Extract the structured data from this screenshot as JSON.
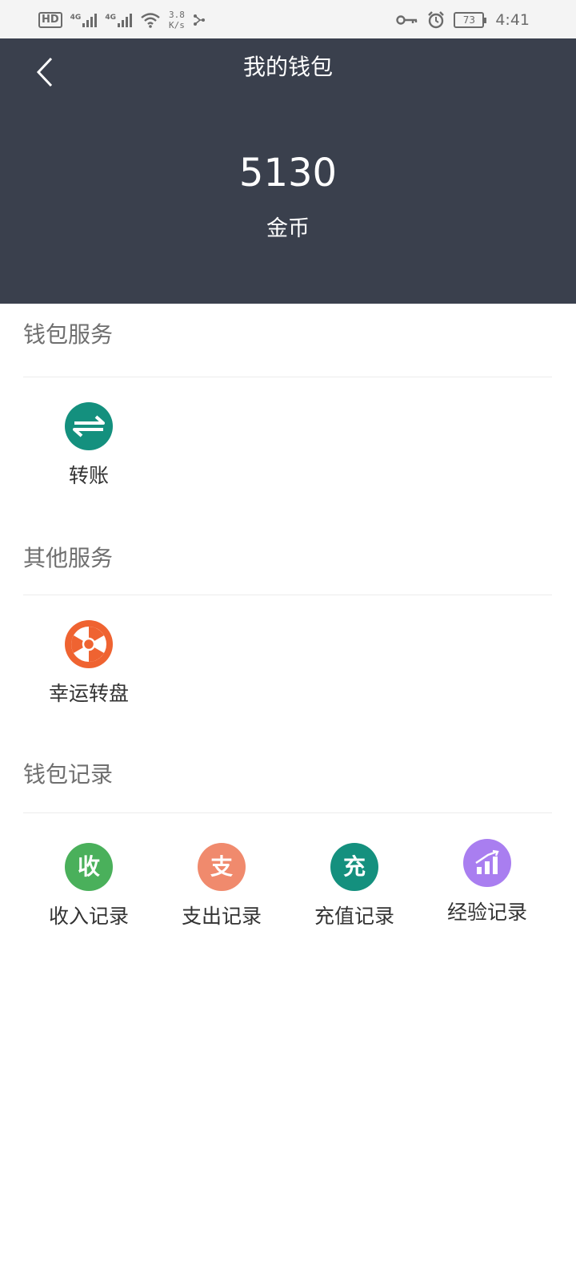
{
  "status_bar": {
    "hd": "HD",
    "network_1": "4G",
    "network_2": "4G",
    "speed_value": "3.8",
    "speed_unit": "K/s",
    "battery": "73",
    "time": "4:41"
  },
  "header": {
    "title": "我的钱包",
    "balance": "5130",
    "unit": "金币",
    "background_color": "#3a404d"
  },
  "sections": [
    {
      "title": "钱包服务",
      "items": [
        {
          "label": "转账",
          "icon": "transfer-arrows-icon",
          "color": "#14907e"
        }
      ]
    },
    {
      "title": "其他服务",
      "items": [
        {
          "label": "幸运转盘",
          "icon": "lucky-wheel-icon",
          "color": "#ef6331"
        }
      ]
    },
    {
      "title": "钱包记录",
      "items": [
        {
          "label": "收入记录",
          "icon": "income-icon",
          "glyph": "收",
          "color": "#4ab05b"
        },
        {
          "label": "支出记录",
          "icon": "expense-icon",
          "glyph": "支",
          "color": "#f08a6d"
        },
        {
          "label": "充值记录",
          "icon": "recharge-icon",
          "glyph": "充",
          "color": "#14907e"
        },
        {
          "label": "经验记录",
          "icon": "experience-chart-icon",
          "color": "#a97ef0"
        }
      ]
    }
  ]
}
